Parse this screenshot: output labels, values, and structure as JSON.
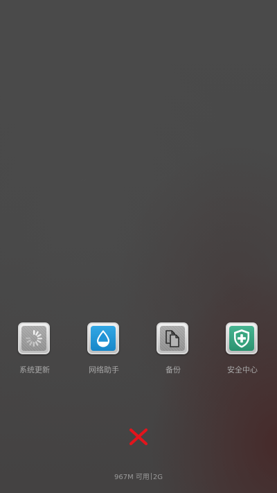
{
  "tools": [
    {
      "label": "系统更新",
      "icon": "system-update-spinner-icon"
    },
    {
      "label": "网络助手",
      "icon": "network-assistant-drop-icon"
    },
    {
      "label": "备份",
      "icon": "backup-documents-icon"
    },
    {
      "label": "安全中心",
      "icon": "security-center-shield-icon"
    }
  ],
  "close_icon": "close-x-icon",
  "memory": {
    "available": "967M 可用",
    "total": "2G"
  },
  "colors": {
    "close": "#e3141c",
    "network_blue": "#1f93d6",
    "security_green": "#3aa680",
    "label": "#a8a8a8"
  }
}
